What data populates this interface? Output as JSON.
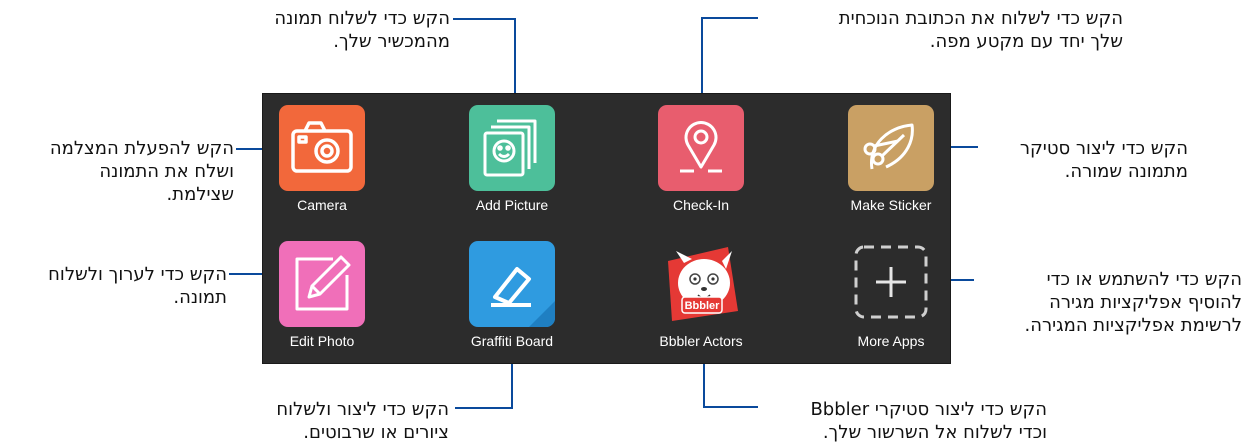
{
  "apps": [
    {
      "label": "Camera",
      "color": "#f2683b",
      "icon": "camera-icon"
    },
    {
      "label": "Add Picture",
      "color": "#4dbf9a",
      "icon": "photo-stack-icon"
    },
    {
      "label": "Check-In",
      "color": "#e85d6e",
      "icon": "map-pin-icon"
    },
    {
      "label": "Make Sticker",
      "color": "#c9a064",
      "icon": "scissors-icon"
    },
    {
      "label": "Edit Photo",
      "color": "#f06fb9",
      "icon": "pencil-icon"
    },
    {
      "label": "Graffiti Board",
      "color": "#2f9be0",
      "icon": "eraser-icon"
    },
    {
      "label": "Bbbler Actors",
      "color": "#e53935",
      "icon": "bbbler-character-icon",
      "badge": "Bbbler"
    },
    {
      "label": "More Apps",
      "color": "#2c2c2c",
      "icon": "plus-icon"
    }
  ],
  "callouts": {
    "camera": "הקש להפעלת המצלמה\nושלח את התמונה\nשצילמת.",
    "add_picture": "הקש כדי לשלוח תמונה\nמהמכשיר שלך.",
    "check_in": "הקש כדי לשלוח את הכתובת הנוכחית\nשלך יחד עם מקטע מפה.",
    "make_sticker": "הקש כדי ליצור סטיקר\nמתמונה שמורה.",
    "edit_photo": "הקש כדי לערוך ולשלוח\nתמונה.",
    "graffiti": "הקש כדי ליצור ולשלוח\nציורים או שרבוטים.",
    "bbbler": "הקש כדי ליצור סטיקרי Bbbler\nוכדי לשלוח אל השרשור שלך.",
    "more_apps": "הקש כדי להשתמש או כדי\nלהוסיף אפליקציות מגירה\nלרשימת אפליקציות המגירה."
  },
  "colors": {
    "panel": "#2c2c2c",
    "leader_line": "#0a4a9c"
  }
}
